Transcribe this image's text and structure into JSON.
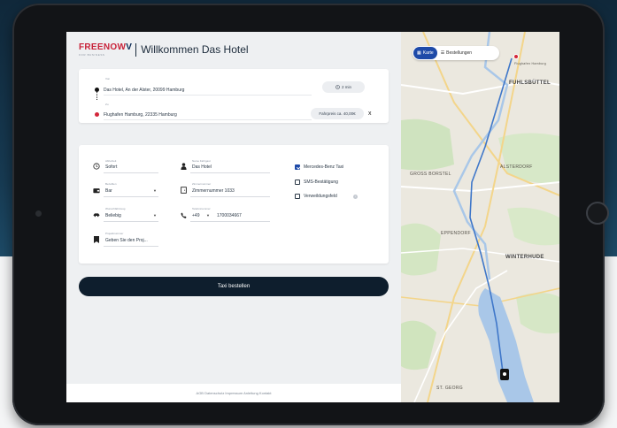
{
  "header": {
    "logo_main": "FREENOW",
    "logo_sub": "FOR BUSINESS",
    "welcome": "Willkommen Das Hotel"
  },
  "route": {
    "from_label": "Von",
    "from_value": "Das Hotel, An der Alster, 20099 Hamburg",
    "eta": "2 min",
    "to_label": "Zu",
    "to_value": "Flughafen Hamburg, 22335 Hamburg",
    "fare": "Fahrpreis ca. 40,00€",
    "clear": "x"
  },
  "details": {
    "time_label": "Abholzeit",
    "time_value": "Sofort",
    "passenger_label": "Name Fahrgast",
    "passenger_value": "Das Hotel",
    "payment_label": "Bezahlen",
    "payment_value": "Bar",
    "room_label": "Zimmernummer",
    "room_value": "Zimmernummer 1033",
    "vehicle_label": "Wunschfahrzeug",
    "vehicle_value": "Beliebig",
    "phone_label": "Telefonnummer",
    "phone_prefix": "+49",
    "phone_value": "1700034667",
    "note_label": "Projektnummer",
    "note_value": "Geben Sie den Proj..."
  },
  "options": [
    {
      "label": "Mercedes-Benz Taxi",
      "checked": true
    },
    {
      "label": "SMS-Bestätigung",
      "checked": false
    },
    {
      "label": "Verweildungsfeld",
      "checked": false
    }
  ],
  "book_button": "Taxi bestellen",
  "footer": "AGB  Datenschutz  Impressum  Anleitung  Kontakt",
  "map": {
    "tab_map": "Karte",
    "tab_orders": "Bestellungen",
    "labels": {
      "fuhlsbuettel": "FUHLSBÜTTEL",
      "hamburg_airport": "Flughafen Hamburg",
      "groß_borstel": "GROSS BORSTEL",
      "eppendorf": "EPPENDORF",
      "winterhude": "WINTERHUDE",
      "alsterdorf": "ALSTERDORF",
      "st_georg": "ST. GEORG"
    }
  },
  "colors": {
    "brand_red": "#c8233a",
    "brand_navy": "#0a2a54",
    "button_dark": "#0e1e2d",
    "accent_blue": "#1e4aa8"
  }
}
